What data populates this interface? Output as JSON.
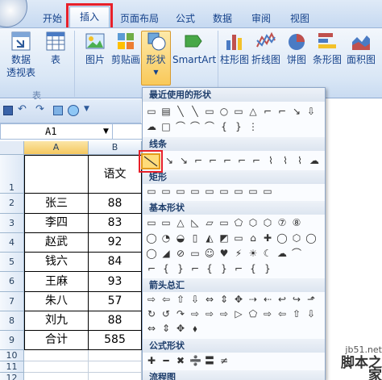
{
  "tabs": [
    {
      "label": "开始",
      "x": 55
    },
    {
      "label": "插入"
    },
    {
      "label": "页面布局"
    },
    {
      "label": "公式"
    },
    {
      "label": "数据"
    },
    {
      "label": "审阅"
    },
    {
      "label": "视图"
    }
  ],
  "ribbon": {
    "pivot": "数据\n透视表",
    "table": "表",
    "group_table": "表",
    "picture": "图片",
    "clipart": "剪贴画",
    "shapes": "形状",
    "smartart": "SmartArt",
    "column": "柱形图",
    "line": "折线图",
    "pie": "饼图",
    "bar": "条形图",
    "area": "面积图",
    "group_illus": "插"
  },
  "namebox": {
    "value": "A1"
  },
  "columns": [
    "A",
    "B"
  ],
  "rows": [
    {
      "num": "1",
      "name": "",
      "score": "语文"
    },
    {
      "num": "2",
      "name": "张三",
      "score": "88"
    },
    {
      "num": "3",
      "name": "李四",
      "score": "83"
    },
    {
      "num": "4",
      "name": "赵武",
      "score": "92"
    },
    {
      "num": "5",
      "name": "钱六",
      "score": "84"
    },
    {
      "num": "6",
      "name": "王麻",
      "score": "93"
    },
    {
      "num": "7",
      "name": "朱八",
      "score": "57"
    },
    {
      "num": "8",
      "name": "刘九",
      "score": "88"
    },
    {
      "num": "9",
      "name": "合计",
      "score": "585"
    },
    {
      "num": "10",
      "name": "",
      "score": ""
    },
    {
      "num": "11",
      "name": "",
      "score": ""
    },
    {
      "num": "12",
      "name": "",
      "score": ""
    }
  ],
  "dropdown": {
    "recent": "最近使用的形状",
    "lines": "线条",
    "rect": "矩形",
    "basic": "基本形状",
    "arrows": "箭头总汇",
    "formula": "公式形状",
    "flowchart": "流程图"
  },
  "watermark": {
    "site": "jb51.net",
    "name": "脚本之家"
  },
  "colors": {
    "highlight": "#e8202a",
    "selected": "#fedc7a"
  }
}
